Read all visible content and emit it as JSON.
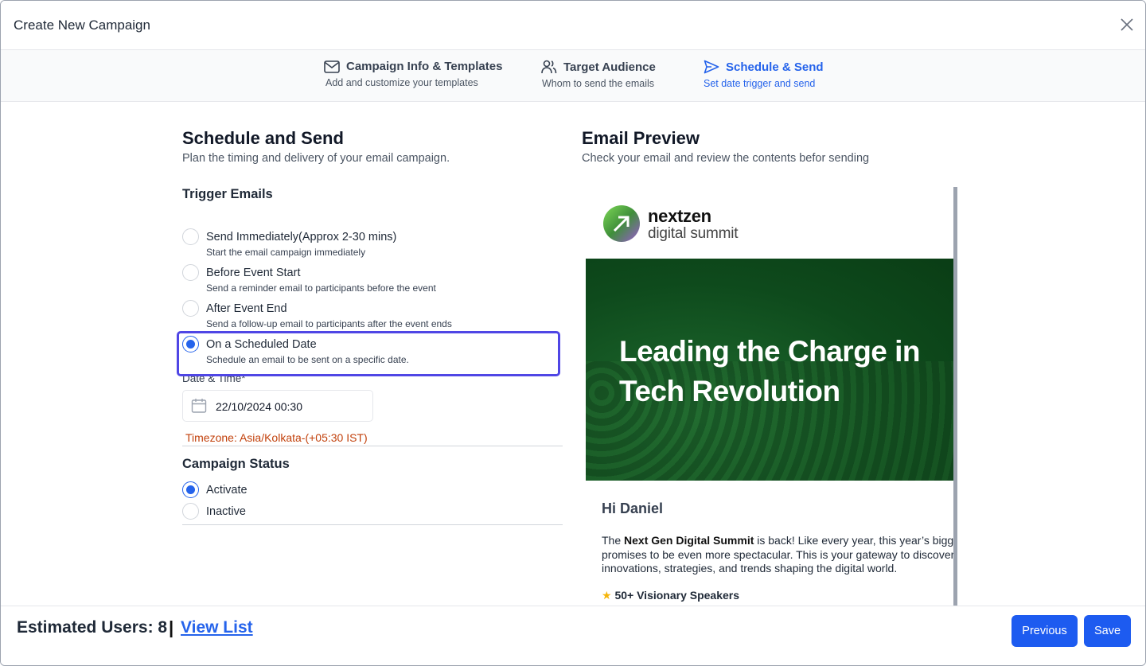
{
  "modal": {
    "title": "Create New Campaign"
  },
  "stepper": [
    {
      "label": "Campaign Info & Templates",
      "sub": "Add and customize your templates",
      "icon": "mail-icon",
      "active": false
    },
    {
      "label": "Target Audience",
      "sub": "Whom to send the emails",
      "icon": "users-icon",
      "active": false
    },
    {
      "label": "Schedule & Send",
      "sub": "Set date trigger and send",
      "icon": "send-icon",
      "active": true
    }
  ],
  "schedule": {
    "title": "Schedule and Send",
    "description": "Plan the timing and delivery of your email campaign.",
    "trigger_heading": "Trigger Emails",
    "options": [
      {
        "label": "Send Immediately(Approx 2-30 mins)",
        "sub": "Start the email campaign immediately",
        "checked": false
      },
      {
        "label": "Before Event Start",
        "sub": "Send a reminder email to participants before the event",
        "checked": false
      },
      {
        "label": "After Event End",
        "sub": "Send a follow-up email to participants after the event ends",
        "checked": false
      },
      {
        "label": "On a Scheduled Date",
        "sub": "Schedule an email to be sent on a specific date.",
        "checked": true
      }
    ],
    "datetime_label": "Date & Time*",
    "datetime_value": "22/10/2024 00:30",
    "timezone": "Timezone: Asia/Kolkata-(+05:30 IST)",
    "status_heading": "Campaign Status",
    "status_options": [
      {
        "label": "Activate",
        "checked": true
      },
      {
        "label": "Inactive",
        "checked": false
      }
    ]
  },
  "preview": {
    "title": "Email Preview",
    "description": "Check your email and review the contents befor sending",
    "logo_line1": "nextzen",
    "logo_line2": "digital summit",
    "hero_headline": "Leading the Charge in Tech Revolution",
    "greeting": "Hi Daniel",
    "body_prefix": "The ",
    "body_bold": "Next Gen Digital Summit",
    "body_line1_rest": " is back! Like every year, this year’s bigg",
    "body_line2": "promises to be even more spectacular. This is your gateway to discover",
    "body_line3": "innovations, strategies, and trends shaping the digital world.",
    "speakers": "50+ Visionary Speakers"
  },
  "footer": {
    "estimated_users": "Estimated Users: 8",
    "separator": "|",
    "view_list": "View List",
    "previous": "Previous",
    "save": "Save"
  },
  "colors": {
    "accent": "#2563eb",
    "focus": "#4f46e5",
    "timezone": "#c2410c",
    "hero_green": "#0e4a1c"
  }
}
